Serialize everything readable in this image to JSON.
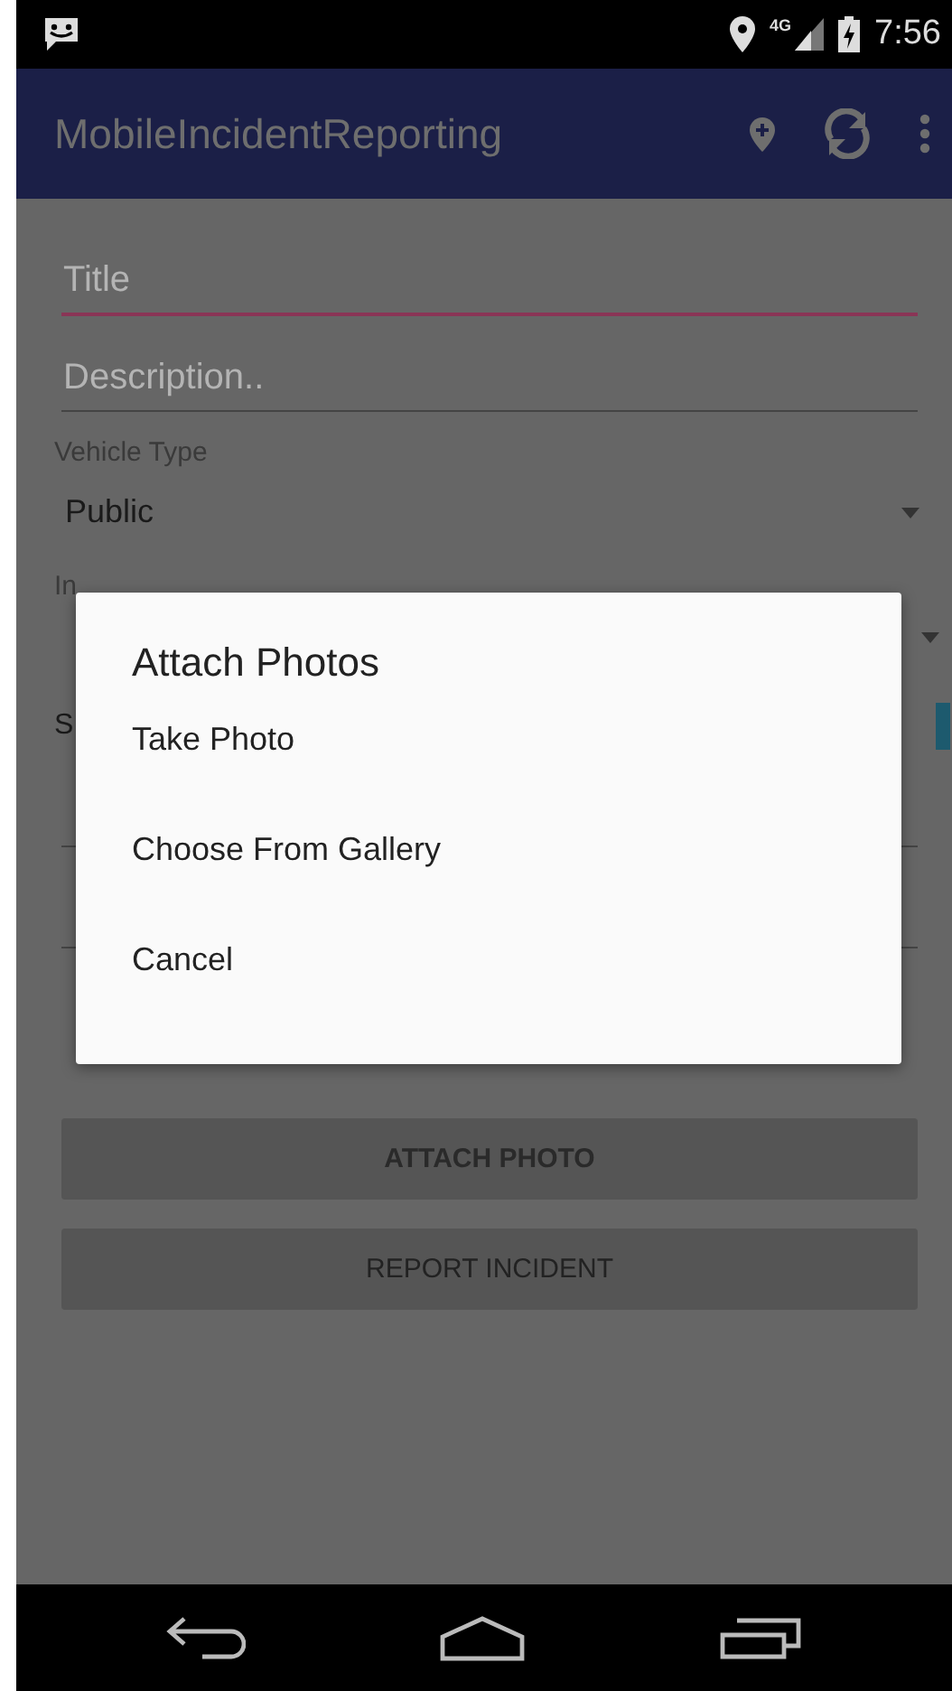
{
  "status_bar": {
    "network_type": "4G",
    "time": "7:56"
  },
  "app_bar": {
    "title": "MobileIncidentReporting"
  },
  "form": {
    "title_field": {
      "placeholder": "Title",
      "focused": true
    },
    "description_field": {
      "placeholder": "Description.."
    },
    "vehicle_type": {
      "label": "Vehicle Type",
      "value": "Public"
    },
    "partial_label": "In",
    "partial_row_label": "S",
    "buttons": [
      {
        "label": "ATTACH PHOTO",
        "bold": true
      },
      {
        "label": "REPORT INCIDENT",
        "bold": false
      }
    ]
  },
  "dialog": {
    "title": "Attach Photos",
    "items": [
      "Take Photo",
      "Choose From Gallery",
      "Cancel"
    ]
  }
}
